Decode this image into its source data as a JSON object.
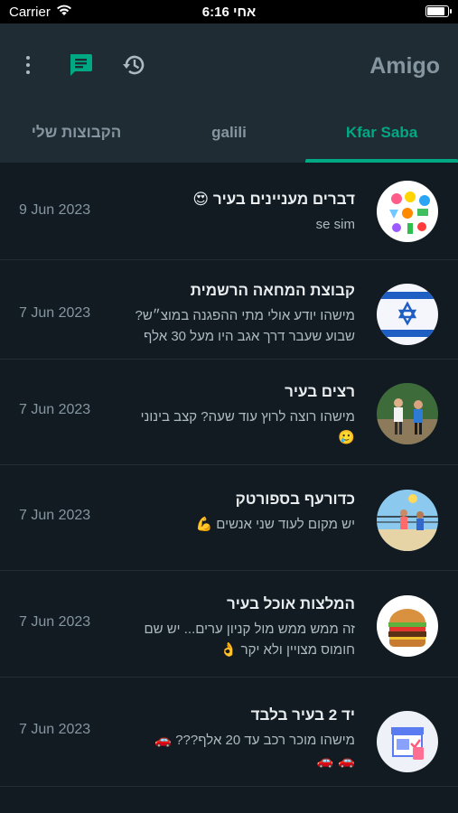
{
  "status_bar": {
    "carrier": "Carrier",
    "time": "6:16 אחי",
    "battery_level": 0.95
  },
  "header": {
    "title": "Amigo",
    "icons": [
      "more-vertical-icon",
      "chat-icon",
      "history-icon"
    ],
    "accent_color": "#00a884"
  },
  "tabs": [
    {
      "label": "Kfar Saba",
      "active": true
    },
    {
      "label": "galili",
      "active": false
    },
    {
      "label": "הקבוצות שלי",
      "active": false
    }
  ],
  "groups": [
    {
      "name": "דברים מעניינים בעיר",
      "name_emoji": "😍",
      "last_message": "se sim",
      "date": "9 Jun 2023",
      "avatar": "stickers"
    },
    {
      "name": "קבוצת המחאה הרשמית",
      "last_message_line1": "מישהו יודע אולי מתי ההפגנה במוצ״ש?",
      "last_message_line2": "שבוע שעבר דרך אגב היו מעל 30 אלף",
      "date": "7 Jun 2023",
      "avatar": "israel-flag"
    },
    {
      "name": "רצים בעיר",
      "last_message_line1": "מישהו רוצה לרוץ עוד שעה? קצב בינוני",
      "last_message_line2": "🥲",
      "date": "7 Jun 2023",
      "avatar": "runners"
    },
    {
      "name": "כדורעף בספורטק",
      "last_message": "יש מקום לעוד שני אנשים 💪",
      "date": "7 Jun 2023",
      "avatar": "volleyball"
    },
    {
      "name": "המלצות אוכל בעיר",
      "last_message_line1": "זה ממש ממש מול קניון ערים... יש שם",
      "last_message_line2": "חומוס מצויין ולא יקר 👌",
      "date": "7 Jun 2023",
      "avatar": "burger"
    },
    {
      "name": "יד 2 בעיר בלבד",
      "last_message_line1": "מישהו מוכר רכב עד 20 אלף??? 🚗",
      "last_message_line2": "🚗 🚗",
      "date": "7 Jun 2023",
      "avatar": "shop"
    }
  ]
}
